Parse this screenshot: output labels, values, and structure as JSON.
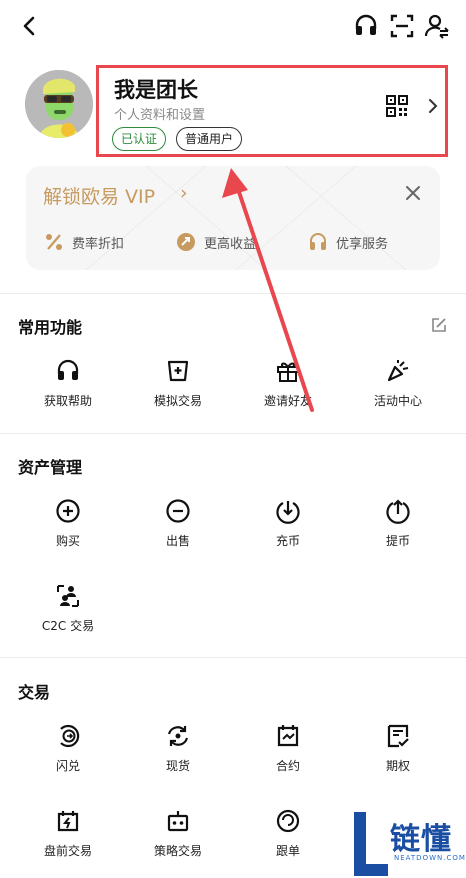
{
  "profile": {
    "username": "我是团长",
    "subtitle": "个人资料和设置",
    "badge_verified": "已认证",
    "badge_user_type": "普通用户"
  },
  "vip": {
    "title": "解锁欧易 VIP",
    "arrow": "›",
    "perks": [
      "费率折扣",
      "更高收益",
      "优享服务"
    ]
  },
  "sections": {
    "common": {
      "title": "常用功能",
      "items": [
        "获取帮助",
        "模拟交易",
        "邀请好友",
        "活动中心"
      ]
    },
    "assets": {
      "title": "资产管理",
      "items": [
        "购买",
        "出售",
        "充币",
        "提币",
        "C2C 交易"
      ]
    },
    "trade": {
      "title": "交易",
      "items": [
        "闪兑",
        "现货",
        "合约",
        "期权",
        "盘前交易",
        "策略交易",
        "跟单"
      ]
    }
  },
  "watermark": {
    "brand": "链懂",
    "site": "NEATDOWN.COM"
  },
  "colors": {
    "highlight": "#e8474d",
    "vip_gold": "#c79a5f",
    "verified_green": "#2f8a3c",
    "watermark_blue": "#1a4ea3"
  },
  "icons": {
    "top": [
      "back-icon",
      "headset-icon",
      "scan-icon",
      "switch-account-icon"
    ],
    "profile": [
      "qr-code-icon",
      "chevron-right-icon"
    ]
  }
}
